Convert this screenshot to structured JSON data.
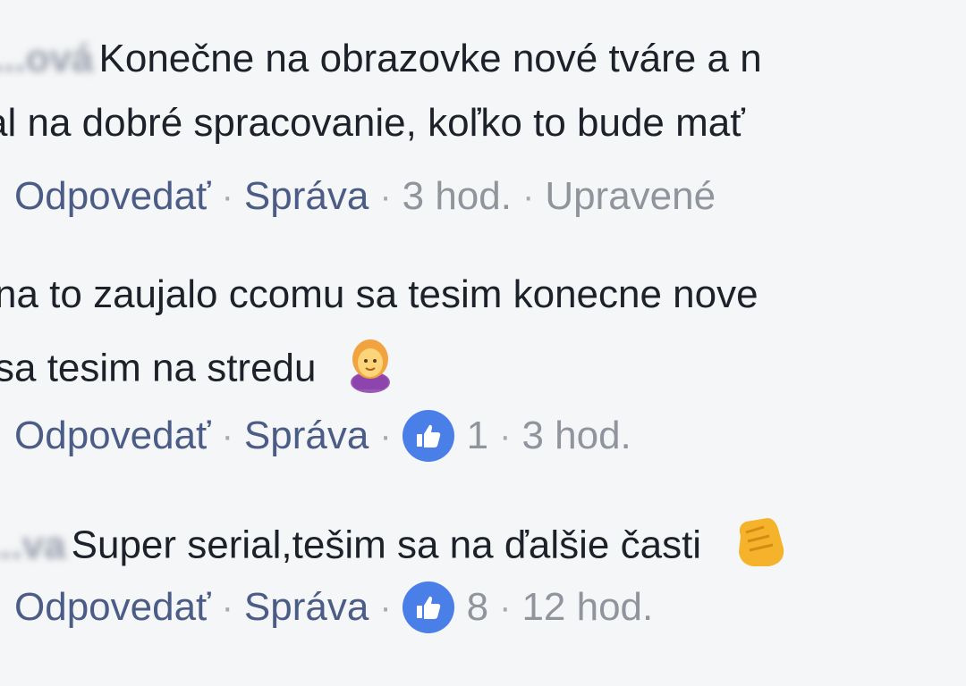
{
  "comments": [
    {
      "author": "...ová K",
      "lines": [
        "Konečne na obrazovke nové tváre a n",
        "al na dobré spracovanie, koľko to bude mať"
      ],
      "actions": {
        "reply": "Odpovedať",
        "message": "Správa",
        "time": "3 hod.",
        "edited": "Upravené"
      }
    },
    {
      "author": "",
      "lines": [
        "na to zaujalo ccomu sa tesim konecne nove",
        "sa tesim na stredu"
      ],
      "emoji": "woman-raising-hand-emoji",
      "actions": {
        "reply": "Odpovedať",
        "message": "Správa",
        "likes": "1",
        "time": "3 hod."
      }
    },
    {
      "author": "...va S",
      "lines": [
        "Super serial,tešim sa na ďalšie časti"
      ],
      "emoji": "clapping-hands-emoji",
      "actions": {
        "reply": "Odpovedať",
        "message": "Správa",
        "likes": "8",
        "time": "12 hod."
      }
    }
  ],
  "separator": "·",
  "colors": {
    "background": "#f5f6f7",
    "text": "#1d2129",
    "link": "#4b5c86",
    "meta": "#90949c",
    "like_badge": "#4a7fe8"
  }
}
